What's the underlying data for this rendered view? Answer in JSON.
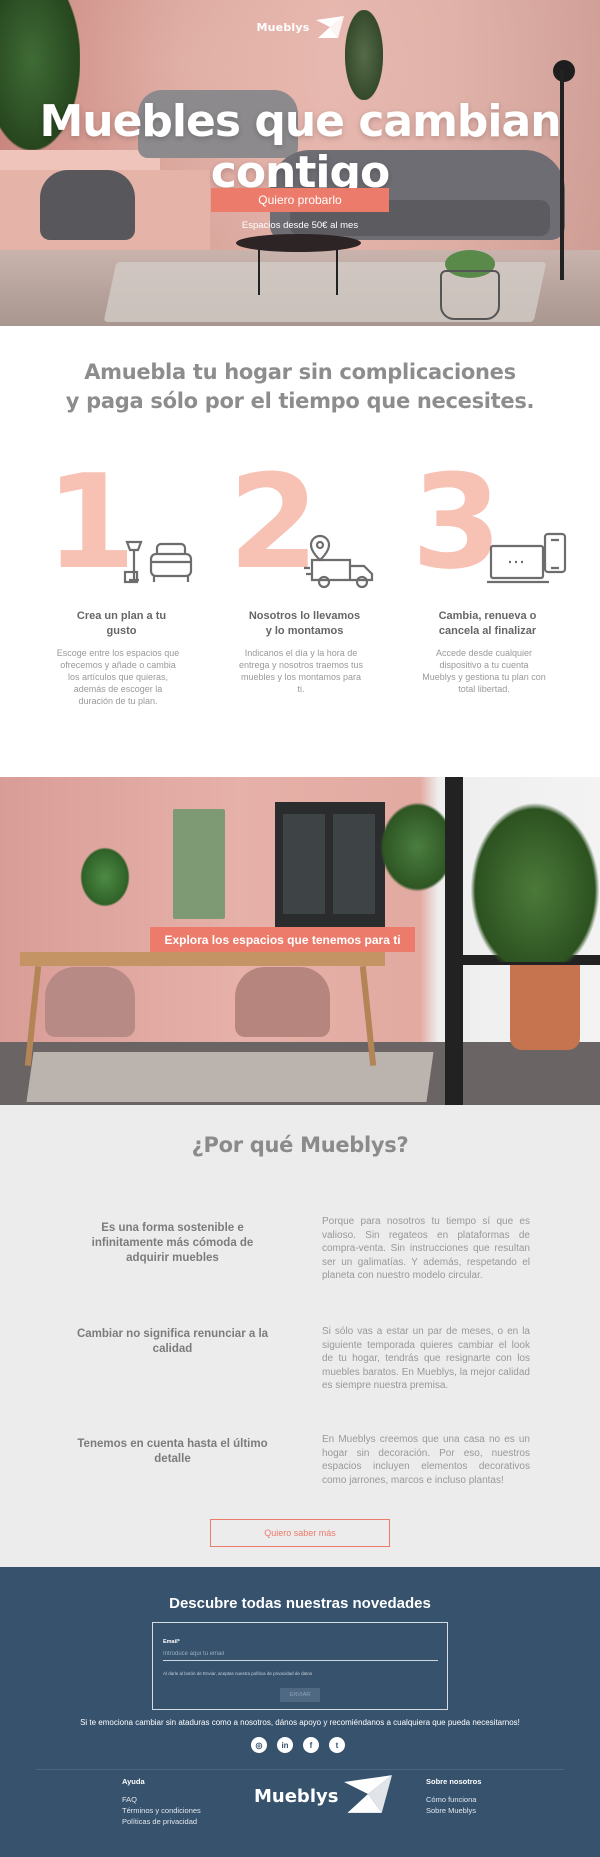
{
  "brand": {
    "name": "Mueblys",
    "accent": "#ec7b6b",
    "footer_bg": "#36526d"
  },
  "hero": {
    "title": "Muebles que cambian contigo",
    "cta_label": "Quiero probarlo",
    "price_text": "Espacios desde 50€ al mes"
  },
  "intro": {
    "line1": "Amuebla tu hogar sin complicaciones",
    "line2": "y paga sólo por el tiempo que necesites."
  },
  "steps": [
    {
      "number": "1",
      "icon": "armchair-icon",
      "title": "Crea un plan a tu gusto",
      "text": "Escoge entre los espacios que ofrecemos y añade o cambia los artículos que quieras, además de escoger la duración de tu plan."
    },
    {
      "number": "2",
      "icon": "delivery-truck-icon",
      "title": "Nosotros lo llevamos y lo montamos",
      "text": "Indicanos el día y la hora de entrega y nosotros traemos tus muebles y los montamos para ti."
    },
    {
      "number": "3",
      "icon": "devices-icon",
      "title": "Cambia, renueva o cancela al finalizar",
      "text": "Accede desde cualquier dispositivo a tu cuenta Mueblys y gestiona tu plan con total libertad."
    }
  ],
  "explore": {
    "button_label": "Explora los espacios que tenemos para ti"
  },
  "why": {
    "title": "¿Por qué Mueblys?",
    "items": [
      {
        "question": "Es una forma sostenible e infinitamente más cómoda de adquirir muebles",
        "answer": "Porque para nosotros tu tiempo sí que es valioso. Sin regateos en plataformas de compra-venta. Sin instrucciones que resultan ser un galimatías. Y además, respetando el planeta con nuestro modelo circular."
      },
      {
        "question": "Cambiar no significa renunciar a la calidad",
        "answer": "Si sólo vas a estar un par de meses, o en la siguiente temporada quieres cambiar el look de tu hogar, tendrás que resignarte con los muebles baratos. En Mueblys, la mejor calidad es siempre nuestra premisa."
      },
      {
        "question": "Tenemos en cuenta hasta el último detalle",
        "answer": "En Mueblys creemos que una casa no es un hogar sin decoración. Por eso, nuestros espacios incluyen elementos decorativos como jarrones, marcos e incluso plantas!"
      }
    ],
    "more_label": "Quiero saber más"
  },
  "newsletter": {
    "title": "Descubre todas nuestras novedades",
    "email_label": "Email*",
    "email_placeholder": "Introduce aquí tu email",
    "legal_text": "Al darle al botón de Enviar, aceptas nuestra política de privacidad de datos",
    "send_label": "ENVIAR"
  },
  "footer": {
    "share_text": "Si te emociona cambiar sin ataduras como a nosotros, dános apoyo y recomiéndanos a cualquiera que pueda necesitarnos!",
    "socials": [
      {
        "icon": "instagram-icon",
        "glyph": "◎"
      },
      {
        "icon": "linkedin-icon",
        "glyph": "in"
      },
      {
        "icon": "facebook-icon",
        "glyph": "f"
      },
      {
        "icon": "twitter-icon",
        "glyph": "t"
      }
    ],
    "help": {
      "title": "Ayuda",
      "links": [
        "FAQ",
        "Términos y condiciones",
        "Políticas de privacidad"
      ]
    },
    "about": {
      "title": "Sobre nosotros",
      "links": [
        "Cómo funciona",
        "Sobre Mueblys"
      ]
    }
  }
}
